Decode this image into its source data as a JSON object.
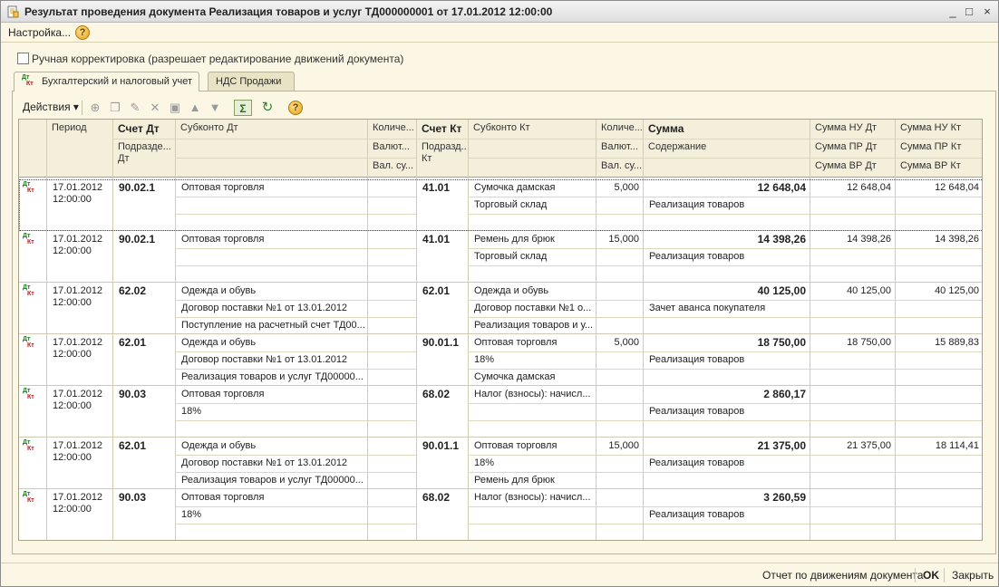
{
  "window": {
    "title": "Результат проведения документа Реализация товаров и услуг ТД000000001 от 17.01.2012 12:00:00",
    "controls": [
      "_",
      "□",
      "×"
    ]
  },
  "menu": {
    "settings": "Настройка...",
    "help": "?"
  },
  "manual_edit": {
    "label": "Ручная корректировка (разрешает редактирование движений документа)",
    "checked": false
  },
  "tabs": [
    {
      "label": "Бухгалтерский и налоговый учет",
      "active": true
    },
    {
      "label": "НДС Продажи",
      "active": false
    }
  ],
  "toolbar": {
    "actions": "Действия ▾",
    "help": "?"
  },
  "columns": {
    "period": "Период",
    "schet_dt": "Счет Дт",
    "podrazd_dt": "Подразде... Дт",
    "subkonto_dt": "Субконто Дт",
    "kol_dt": "Количе...",
    "val_dt": "Валют...",
    "valsum_dt": "Вал. су...",
    "schet_kt": "Счет Кт",
    "podrazd_kt": "Подразд... Кт",
    "subkonto_kt": "Субконто Кт",
    "kol_kt": "Количе...",
    "val_kt": "Валют...",
    "valsum_kt": "Вал. су...",
    "summa": "Сумма",
    "soderzhanie": "Содержание",
    "nu_dt": "Сумма НУ Дт",
    "pr_dt": "Сумма ПР Дт",
    "vr_dt": "Сумма ВР Дт",
    "nu_kt": "Сумма НУ Кт",
    "pr_kt": "Сумма ПР Кт",
    "vr_kt": "Сумма ВР Кт"
  },
  "rows": [
    {
      "icon": "Дт Кт",
      "date": "17.01.2012",
      "time": "12:00:00",
      "schet_dt": "90.02.1",
      "sub_dt": [
        "Оптовая торговля",
        "",
        ""
      ],
      "kol_dt": "",
      "schet_kt": "41.01",
      "sub_kt": [
        "Сумочка дамская",
        "Торговый склад",
        ""
      ],
      "kol_kt": "5,000",
      "summa": "12 648,04",
      "soderzhanie": "Реализация товаров",
      "nu_dt": "12 648,04",
      "nu_kt": "12 648,04"
    },
    {
      "icon": "Дт Кт",
      "date": "17.01.2012",
      "time": "12:00:00",
      "schet_dt": "90.02.1",
      "sub_dt": [
        "Оптовая торговля",
        "",
        ""
      ],
      "kol_dt": "",
      "schet_kt": "41.01",
      "sub_kt": [
        "Ремень для брюк",
        "Торговый склад",
        ""
      ],
      "kol_kt": "15,000",
      "summa": "14 398,26",
      "soderzhanie": "Реализация товаров",
      "nu_dt": "14 398,26",
      "nu_kt": "14 398,26"
    },
    {
      "icon": "Дт Кт",
      "date": "17.01.2012",
      "time": "12:00:00",
      "schet_dt": "62.02",
      "sub_dt": [
        "Одежда и обувь",
        "Договор поставки №1 от 13.01.2012",
        "Поступление на расчетный счет ТД00..."
      ],
      "kol_dt": "",
      "schet_kt": "62.01",
      "sub_kt": [
        "Одежда и обувь",
        "Договор поставки №1 о...",
        "Реализация товаров и у..."
      ],
      "kol_kt": "",
      "summa": "40 125,00",
      "soderzhanie": "Зачет аванса покупателя",
      "nu_dt": "40 125,00",
      "nu_kt": "40 125,00"
    },
    {
      "icon": "Дт Кт",
      "date": "17.01.2012",
      "time": "12:00:00",
      "schet_dt": "62.01",
      "sub_dt": [
        "Одежда и обувь",
        "Договор поставки №1 от 13.01.2012",
        "Реализация товаров и услуг ТД00000..."
      ],
      "kol_dt": "",
      "schet_kt": "90.01.1",
      "sub_kt": [
        "Оптовая торговля",
        "18%",
        "Сумочка дамская"
      ],
      "kol_kt": "5,000",
      "summa": "18 750,00",
      "soderzhanie": "Реализация товаров",
      "nu_dt": "18 750,00",
      "nu_kt": "15 889,83"
    },
    {
      "icon": "Дт Кт",
      "date": "17.01.2012",
      "time": "12:00:00",
      "schet_dt": "90.03",
      "sub_dt": [
        "Оптовая торговля",
        "18%",
        ""
      ],
      "kol_dt": "",
      "schet_kt": "68.02",
      "sub_kt": [
        "Налог (взносы): начисл...",
        "",
        ""
      ],
      "kol_kt": "",
      "summa": "2 860,17",
      "soderzhanie": "Реализация товаров",
      "nu_dt": "",
      "nu_kt": ""
    },
    {
      "icon": "Дт Кт",
      "date": "17.01.2012",
      "time": "12:00:00",
      "schet_dt": "62.01",
      "sub_dt": [
        "Одежда и обувь",
        "Договор поставки №1 от 13.01.2012",
        "Реализация товаров и услуг ТД00000..."
      ],
      "kol_dt": "",
      "schet_kt": "90.01.1",
      "sub_kt": [
        "Оптовая торговля",
        "18%",
        "Ремень для брюк"
      ],
      "kol_kt": "15,000",
      "summa": "21 375,00",
      "soderzhanie": "Реализация товаров",
      "nu_dt": "21 375,00",
      "nu_kt": "18 114,41"
    },
    {
      "icon": "Дт Кт",
      "date": "17.01.2012",
      "time": "12:00:00",
      "schet_dt": "90.03",
      "sub_dt": [
        "Оптовая торговля",
        "18%",
        ""
      ],
      "kol_dt": "",
      "schet_kt": "68.02",
      "sub_kt": [
        "Налог (взносы): начисл...",
        "",
        ""
      ],
      "kol_kt": "",
      "summa": "3 260,59",
      "soderzhanie": "Реализация товаров",
      "nu_dt": "",
      "nu_kt": ""
    }
  ],
  "footer": {
    "report": "Отчет по движениям документа",
    "ok": "OK",
    "close": "Закрыть"
  },
  "colors": {
    "background": "#fbf7e4",
    "header": "#f3efdb",
    "border": "#a8a28a",
    "dt_icon": "#1a7a1a",
    "kt_icon": "#c01818"
  }
}
